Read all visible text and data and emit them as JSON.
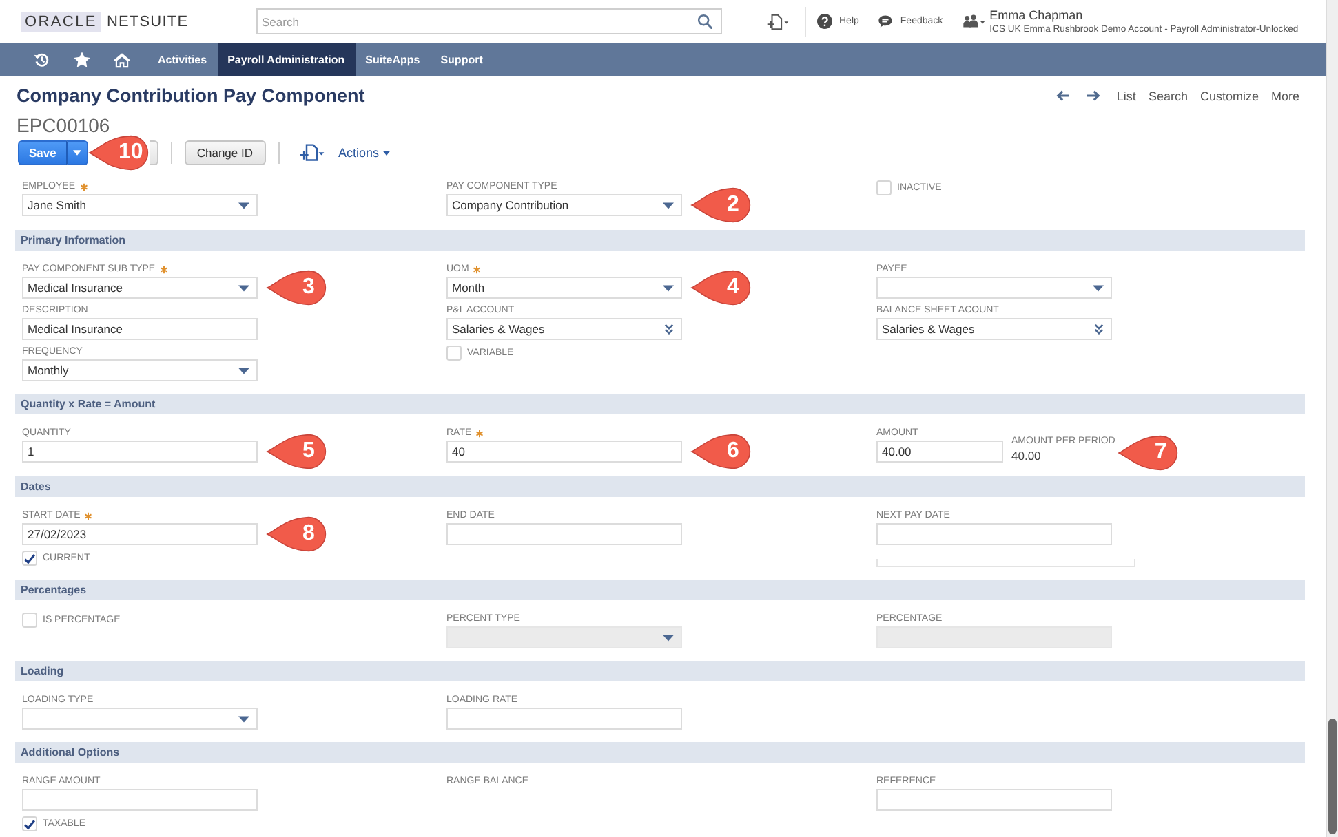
{
  "header": {
    "logo": {
      "brand": "ORACLE",
      "product": "NETSUITE"
    },
    "search": {
      "placeholder": "Search"
    },
    "links": [
      {
        "kind": "help",
        "label": "Help"
      },
      {
        "kind": "feedback",
        "label": "Feedback"
      }
    ],
    "user": {
      "name": "Emma Chapman",
      "account": "ICS UK Emma Rushbrook Demo Account - Payroll Administrator-Unlocked"
    }
  },
  "nav": {
    "items": [
      {
        "label": "Activities",
        "selected": false
      },
      {
        "label": "Payroll Administration",
        "selected": true
      },
      {
        "label": "SuiteApps",
        "selected": false
      },
      {
        "label": "Support",
        "selected": false
      }
    ]
  },
  "page": {
    "title": "Company Contribution Pay Component",
    "record_id": "EPC00106",
    "links": [
      "List",
      "Search",
      "Customize",
      "More"
    ]
  },
  "toolbar": {
    "save": "Save",
    "callout": "10",
    "buttons": [
      "Change ID"
    ],
    "actions": "Actions"
  },
  "top_fields": {
    "columns": [
      [
        {
          "kind": "dropdown",
          "label": "EMPLOYEE",
          "required": true,
          "value": "Jane Smith",
          "disabled": false
        }
      ],
      [
        {
          "kind": "dropdown",
          "label": "PAY COMPONENT TYPE",
          "required": false,
          "value": "Company Contribution",
          "disabled": false,
          "callout": "2"
        }
      ],
      [
        {
          "kind": "checkbox",
          "label": "INACTIVE",
          "checked": false
        }
      ]
    ]
  },
  "sections": [
    {
      "title": "Primary Information",
      "columns": [
        [
          {
            "kind": "dropdown",
            "label": "PAY COMPONENT SUB TYPE",
            "required": true,
            "value": "Medical Insurance",
            "disabled": false,
            "callout": "3"
          },
          {
            "kind": "text",
            "label": "DESCRIPTION",
            "required": false,
            "value": "Medical Insurance",
            "disabled": false
          },
          {
            "kind": "dropdown",
            "label": "FREQUENCY",
            "required": false,
            "value": "Monthly",
            "disabled": false
          }
        ],
        [
          {
            "kind": "dropdown",
            "label": "UOM",
            "required": true,
            "value": "Month",
            "disabled": false,
            "callout": "4"
          },
          {
            "kind": "popup",
            "label": "P&L ACCOUNT",
            "required": false,
            "value": "Salaries & Wages",
            "disabled": false
          },
          {
            "kind": "checkbox",
            "label": "VARIABLE",
            "checked": false
          }
        ],
        [
          {
            "kind": "dropdown",
            "label": "PAYEE",
            "required": false,
            "disabled": false
          },
          {
            "kind": "popup",
            "label": "BALANCE SHEET ACOUNT",
            "required": false,
            "value": "Salaries & Wages",
            "disabled": false
          }
        ]
      ]
    },
    {
      "title": "Quantity x Rate = Amount",
      "columns": [
        [
          {
            "kind": "text",
            "label": "QUANTITY",
            "required": false,
            "value": "1",
            "disabled": false,
            "callout": "5"
          }
        ],
        [
          {
            "kind": "text",
            "label": "RATE",
            "required": true,
            "value": "40",
            "disabled": false,
            "callout": "6"
          }
        ],
        [
          {
            "kind": "text",
            "label": "AMOUNT",
            "required": false,
            "value": "40.00",
            "disabled": false,
            "beside": {
              "label": "AMOUNT PER PERIOD",
              "value": "40.00",
              "callout": "7"
            }
          }
        ]
      ]
    },
    {
      "title": "Dates",
      "columns": [
        [
          {
            "kind": "text",
            "label": "START DATE",
            "required": true,
            "value": "27/02/2023",
            "disabled": false,
            "callout": "8"
          },
          {
            "kind": "checkbox",
            "label": "CURRENT",
            "checked": true
          }
        ],
        [
          {
            "kind": "text",
            "label": "END DATE",
            "required": false,
            "disabled": false
          }
        ],
        [
          {
            "kind": "text",
            "label": "NEXT PAY DATE",
            "required": false,
            "disabled": false
          },
          {
            "kind": "rule"
          }
        ]
      ]
    },
    {
      "title": "Percentages",
      "columns": [
        [
          {
            "kind": "checkbox",
            "label": "IS PERCENTAGE",
            "checked": false
          }
        ],
        [
          {
            "kind": "dropdown",
            "label": "PERCENT TYPE",
            "required": false,
            "disabled": true
          }
        ],
        [
          {
            "kind": "text",
            "label": "PERCENTAGE",
            "required": false,
            "disabled": true
          }
        ]
      ]
    },
    {
      "title": "Loading",
      "columns": [
        [
          {
            "kind": "dropdown",
            "label": "LOADING TYPE",
            "required": false,
            "disabled": false
          }
        ],
        [
          {
            "kind": "text",
            "label": "LOADING RATE",
            "required": false,
            "disabled": false
          }
        ],
        []
      ]
    },
    {
      "title": "Additional Options",
      "columns": [
        [
          {
            "kind": "text",
            "label": "RANGE AMOUNT",
            "required": false,
            "disabled": false
          },
          {
            "kind": "checkbox",
            "label": "TAXABLE",
            "checked": true
          }
        ],
        [
          {
            "kind": "display",
            "label": "RANGE BALANCE"
          }
        ],
        [
          {
            "kind": "text",
            "label": "REFERENCE",
            "required": false,
            "disabled": false
          }
        ]
      ]
    }
  ]
}
